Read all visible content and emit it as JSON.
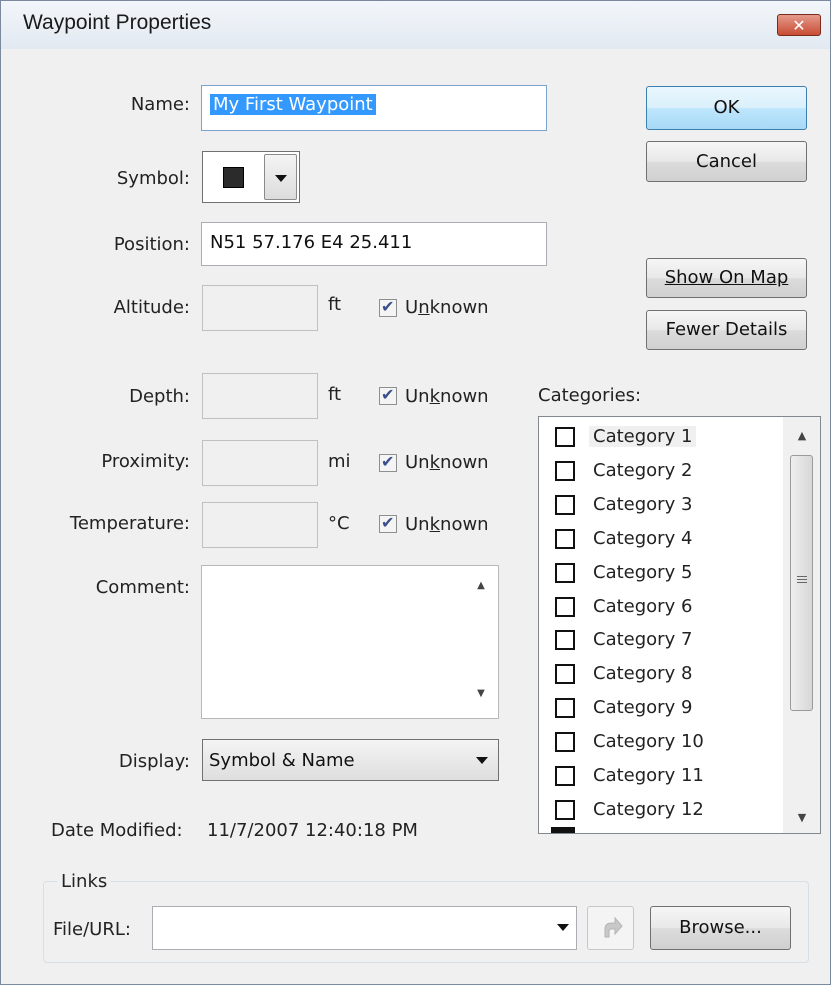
{
  "window": {
    "title": "Waypoint Properties",
    "close_icon": "close-icon",
    "close_glyph": "✕"
  },
  "fields": {
    "name_label": "Name:",
    "name_value": "My First Waypoint",
    "symbol_label": "Symbol:",
    "symbol_icon": "black-square-icon",
    "position_label": "Position:",
    "position_value": "N51 57.176 E4 25.411",
    "altitude_label": "Altitude:",
    "altitude_unit": "ft",
    "depth_label": "Depth:",
    "depth_unit": "ft",
    "proximity_label": "Proximity:",
    "proximity_unit": "mi",
    "temperature_label": "Temperature:",
    "temperature_unit": "°C",
    "unknown_label": "Unknown",
    "comment_label": "Comment:",
    "display_label": "Display:",
    "display_value": "Symbol & Name",
    "date_modified_label": "Date Modified:",
    "date_modified_value": "11/7/2007 12:40:18 PM"
  },
  "buttons": {
    "ok": "OK",
    "cancel": "Cancel",
    "show_on_map": "Show On Map",
    "fewer_details": "Fewer Details",
    "browse": "Browse..."
  },
  "categories": {
    "label": "Categories:",
    "items": [
      "Category 1",
      "Category 2",
      "Category 3",
      "Category 4",
      "Category 5",
      "Category 6",
      "Category 7",
      "Category 8",
      "Category 9",
      "Category 10",
      "Category 11",
      "Category 12"
    ]
  },
  "links": {
    "group_label": "Links",
    "file_url_label": "File/URL:",
    "file_url_value": "",
    "goto_icon": "arrow-right-icon"
  },
  "colors": {
    "selection": "#3399ff",
    "close_button": "#c84c34"
  }
}
